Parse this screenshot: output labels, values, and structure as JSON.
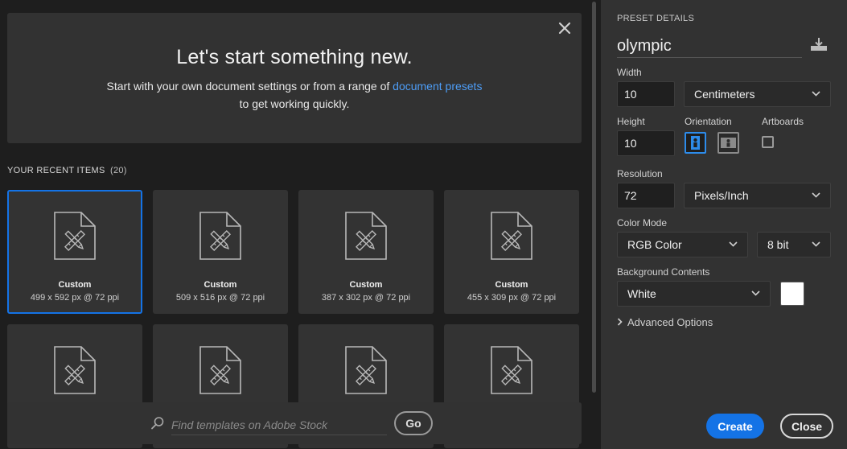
{
  "hero": {
    "title": "Let's start something new.",
    "line1_prefix": "Start with your own document settings or from a range of ",
    "line1_link": "document presets",
    "line2": "to get working quickly."
  },
  "recent": {
    "heading": "YOUR RECENT ITEMS",
    "count": "(20)",
    "items": [
      {
        "name": "Custom",
        "size": "499 x 592 px @ 72 ppi",
        "selected": true
      },
      {
        "name": "Custom",
        "size": "509 x 516 px @ 72 ppi",
        "selected": false
      },
      {
        "name": "Custom",
        "size": "387 x 302 px @ 72 ppi",
        "selected": false
      },
      {
        "name": "Custom",
        "size": "455 x 309 px @ 72 ppi",
        "selected": false
      },
      {
        "name": "",
        "size": "",
        "selected": false
      },
      {
        "name": "",
        "size": "",
        "selected": false
      },
      {
        "name": "",
        "size": "",
        "selected": false
      },
      {
        "name": "",
        "size": "",
        "selected": false
      }
    ]
  },
  "search": {
    "placeholder": "Find templates on Adobe Stock",
    "go_label": "Go"
  },
  "preset": {
    "heading": "PRESET DETAILS",
    "name": "olympic",
    "width_label": "Width",
    "width_value": "10",
    "unit": "Centimeters",
    "height_label": "Height",
    "height_value": "10",
    "orientation_label": "Orientation",
    "artboards_label": "Artboards",
    "resolution_label": "Resolution",
    "resolution_value": "72",
    "resolution_unit": "Pixels/Inch",
    "color_mode_label": "Color Mode",
    "color_mode": "RGB Color",
    "bit_depth": "8 bit",
    "background_label": "Background Contents",
    "background": "White",
    "advanced_label": "Advanced Options"
  },
  "actions": {
    "create": "Create",
    "close": "Close"
  },
  "colors": {
    "accent": "#1473e6",
    "link": "#4d9df7",
    "background_swatch": "#ffffff"
  }
}
